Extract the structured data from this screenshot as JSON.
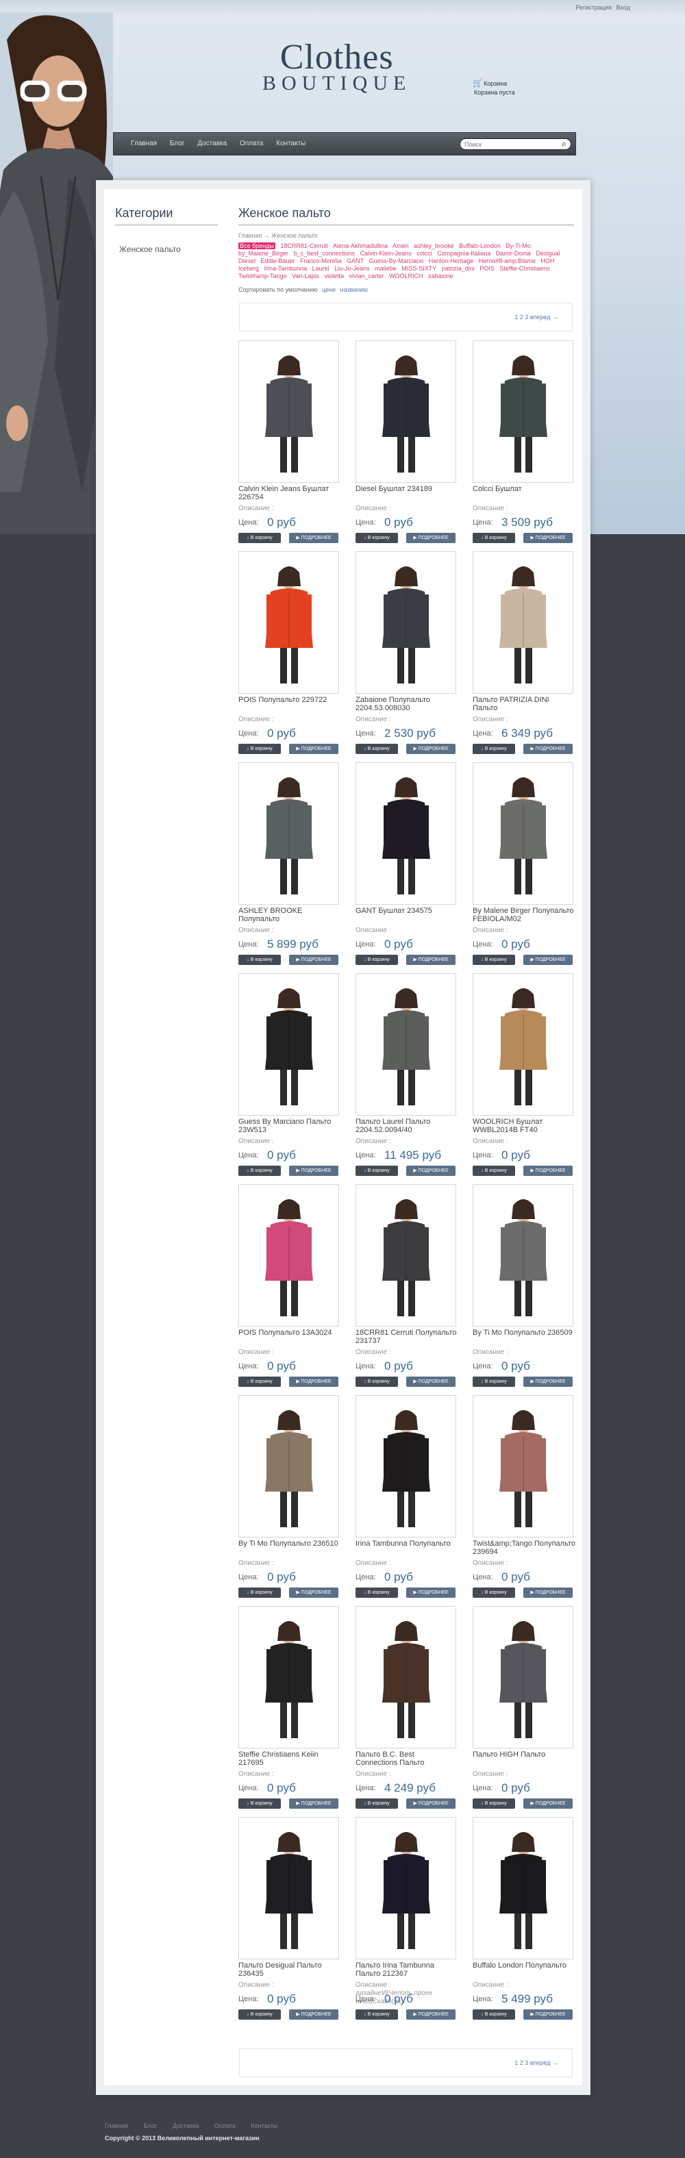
{
  "top": {
    "register": "Регистрация",
    "login": "Вход"
  },
  "logo": {
    "line1": "Clothes",
    "line2": "BOUTIQUE"
  },
  "cart": {
    "label": "Корзина",
    "status": "Корзина пуста"
  },
  "nav": [
    "Главная",
    "Блог",
    "Доставка",
    "Оплата",
    "Контакты"
  ],
  "search": {
    "placeholder": "Поиск"
  },
  "sidebar": {
    "title": "Категории",
    "items": [
      "Женское пальто"
    ]
  },
  "main": {
    "title": "Женское пальто",
    "crumbs": [
      "Главная",
      "→",
      "Женское пальто"
    ],
    "brands": [
      "Все бренды",
      "18CRR81-Cerruti",
      "Alena-Akhmadullina",
      "Amen",
      "ashley_brooke",
      "Buffalo-London",
      "By-Ti-Mo",
      "by_Malene_Birger",
      "b_c_best_connections",
      "Calvin-Klein-Jeans",
      "colcci",
      "Compagnia-Italiana",
      "Damir-Doma",
      "Desigual",
      "Diesel",
      "Eddie-Bauer",
      "Franco-Morelia",
      "GANT",
      "Guess-By-Marciano",
      "Hanlon-Heritage",
      "Herno#8-amp;Blame",
      "HOH",
      "Iceberg",
      "Irina-Tambunna",
      "Laurel",
      "Liu-Jo-Jeans",
      "maliebe",
      "MISS-SIXTY",
      "patrizia_dini",
      "POIS",
      "Steffie-Christiaens",
      "Twist#amp-Tango",
      "Vari-Lapis",
      "violetta",
      "vivian_carter",
      "WOOLRICH",
      "zabaione"
    ],
    "sort_label": "Сортировать по умолчанию",
    "sort_options": [
      "цене",
      "названию"
    ],
    "pagination": "1 2 3 вперед →"
  },
  "product_common": {
    "desc_label": "Описание :",
    "price_label": "Цена:",
    "cart_button": "В корзину",
    "more_button": "ПОДРОБНЕЕ"
  },
  "products": [
    {
      "name": "Calvin Klein Jeans Бушлат 226754",
      "price": "0 руб",
      "desc": "Описание :",
      "coat_color": "#4d4f55"
    },
    {
      "name": "Diesel Бушлат 234189",
      "price": "0 руб",
      "desc": "Описание :",
      "coat_color": "#2a2c35"
    },
    {
      "name": "Colcci Бушлат",
      "price": "3 509 руб",
      "desc": "Описание :",
      "coat_color": "#3e4a48"
    },
    {
      "name": "POIS Полупальто 229722",
      "price": "0 руб",
      "desc": "Описание :",
      "coat_color": "#e2421f"
    },
    {
      "name": "Zabaione Полупальто 2204.53.008030",
      "price": "2 530 руб",
      "desc": "Описание :",
      "coat_color": "#3a3e44"
    },
    {
      "name": "Пальто PATRIZIA DINI Пальто",
      "price": "6 349 руб",
      "desc": "Описание :",
      "coat_color": "#c8b7a0"
    },
    {
      "name": "ASHLEY BROOKE Полупальто",
      "price": "5 899 руб",
      "desc": "Описание :",
      "coat_color": "#5a5f62"
    },
    {
      "name": "GANT Бушлат 234575",
      "price": "0 руб",
      "desc": "Описание :",
      "coat_color": "#1f1b25"
    },
    {
      "name": "By Malene Birger Полупальто FEBIOLA/M02",
      "price": "0 руб",
      "desc": "Описание :",
      "coat_color": "#6b6d68"
    },
    {
      "name": "Guess By Marciano Пальто 23W513",
      "price": "0 руб",
      "desc": "Описание :",
      "coat_color": "#222222"
    },
    {
      "name": "Пальто Laurel Пальто 2204.52.0094/40",
      "price": "11 495 руб",
      "desc": "Описание :",
      "coat_color": "#5b5e5a"
    },
    {
      "name": "WOOLRICH Бушлат WWBL2014B FT40",
      "price": "0 руб",
      "desc": "Описание :",
      "coat_color": "#b78a5a"
    },
    {
      "name": "POIS Полупальто 13A3024",
      "price": "0 руб",
      "desc": "Описание :",
      "coat_color": "#d04a7a"
    },
    {
      "name": "18CRR81 Cerruti Полупальто 231737",
      "price": "0 руб",
      "desc": "Описание :",
      "coat_color": "#3d3c3e"
    },
    {
      "name": "By Ti Mo Полупальто 236509",
      "price": "0 руб",
      "desc": "Описание :",
      "coat_color": "#6d6c6c"
    },
    {
      "name": "By Ti Mo Полупальто 236510",
      "price": "0 руб",
      "desc": "Описание :",
      "coat_color": "#8a7866"
    },
    {
      "name": "Irina Tambunna Полупальто",
      "price": "0 руб",
      "desc": "Описание :",
      "coat_color": "#1e1b1d"
    },
    {
      "name": "Twist&amp;Tango Полупальто 239694",
      "price": "0 руб",
      "desc": "Описание :",
      "coat_color": "#a36b62"
    },
    {
      "name": "Steffie Christiaens Keiin 217695",
      "price": "0 руб",
      "desc": "Описание :",
      "coat_color": "#222222"
    },
    {
      "name": "Пальто B.C. Best Connections Пальто",
      "price": "4 249 руб",
      "desc": "Описание :",
      "coat_color": "#4a3228"
    },
    {
      "name": "Пальто HIGH Пальто",
      "price": "0 руб",
      "desc": "Описание :",
      "coat_color": "#55555b"
    },
    {
      "name": "Пальто Desigual Пальто 236435",
      "price": "0 руб",
      "desc": "Описание :",
      "coat_color": "#1d1d22"
    },
    {
      "name": "Пальто Irina Tambunna Пальто 212367",
      "price": "0 руб",
      "desc": "Описание : дизайнеИ(Чеполь,проек ника)Скавб(ес...",
      "coat_color": "#1c1a2a"
    },
    {
      "name": "Buffalo London Полупальто",
      "price": "5 499 руб",
      "desc": "Описание :",
      "coat_color": "#1a1a1c"
    }
  ],
  "footer": {
    "menu": [
      "Главная",
      "Блог",
      "Доставка",
      "Оплата",
      "Контакты"
    ],
    "copyright": "Copyright © 2013 Великолепный интернет-магазин"
  }
}
